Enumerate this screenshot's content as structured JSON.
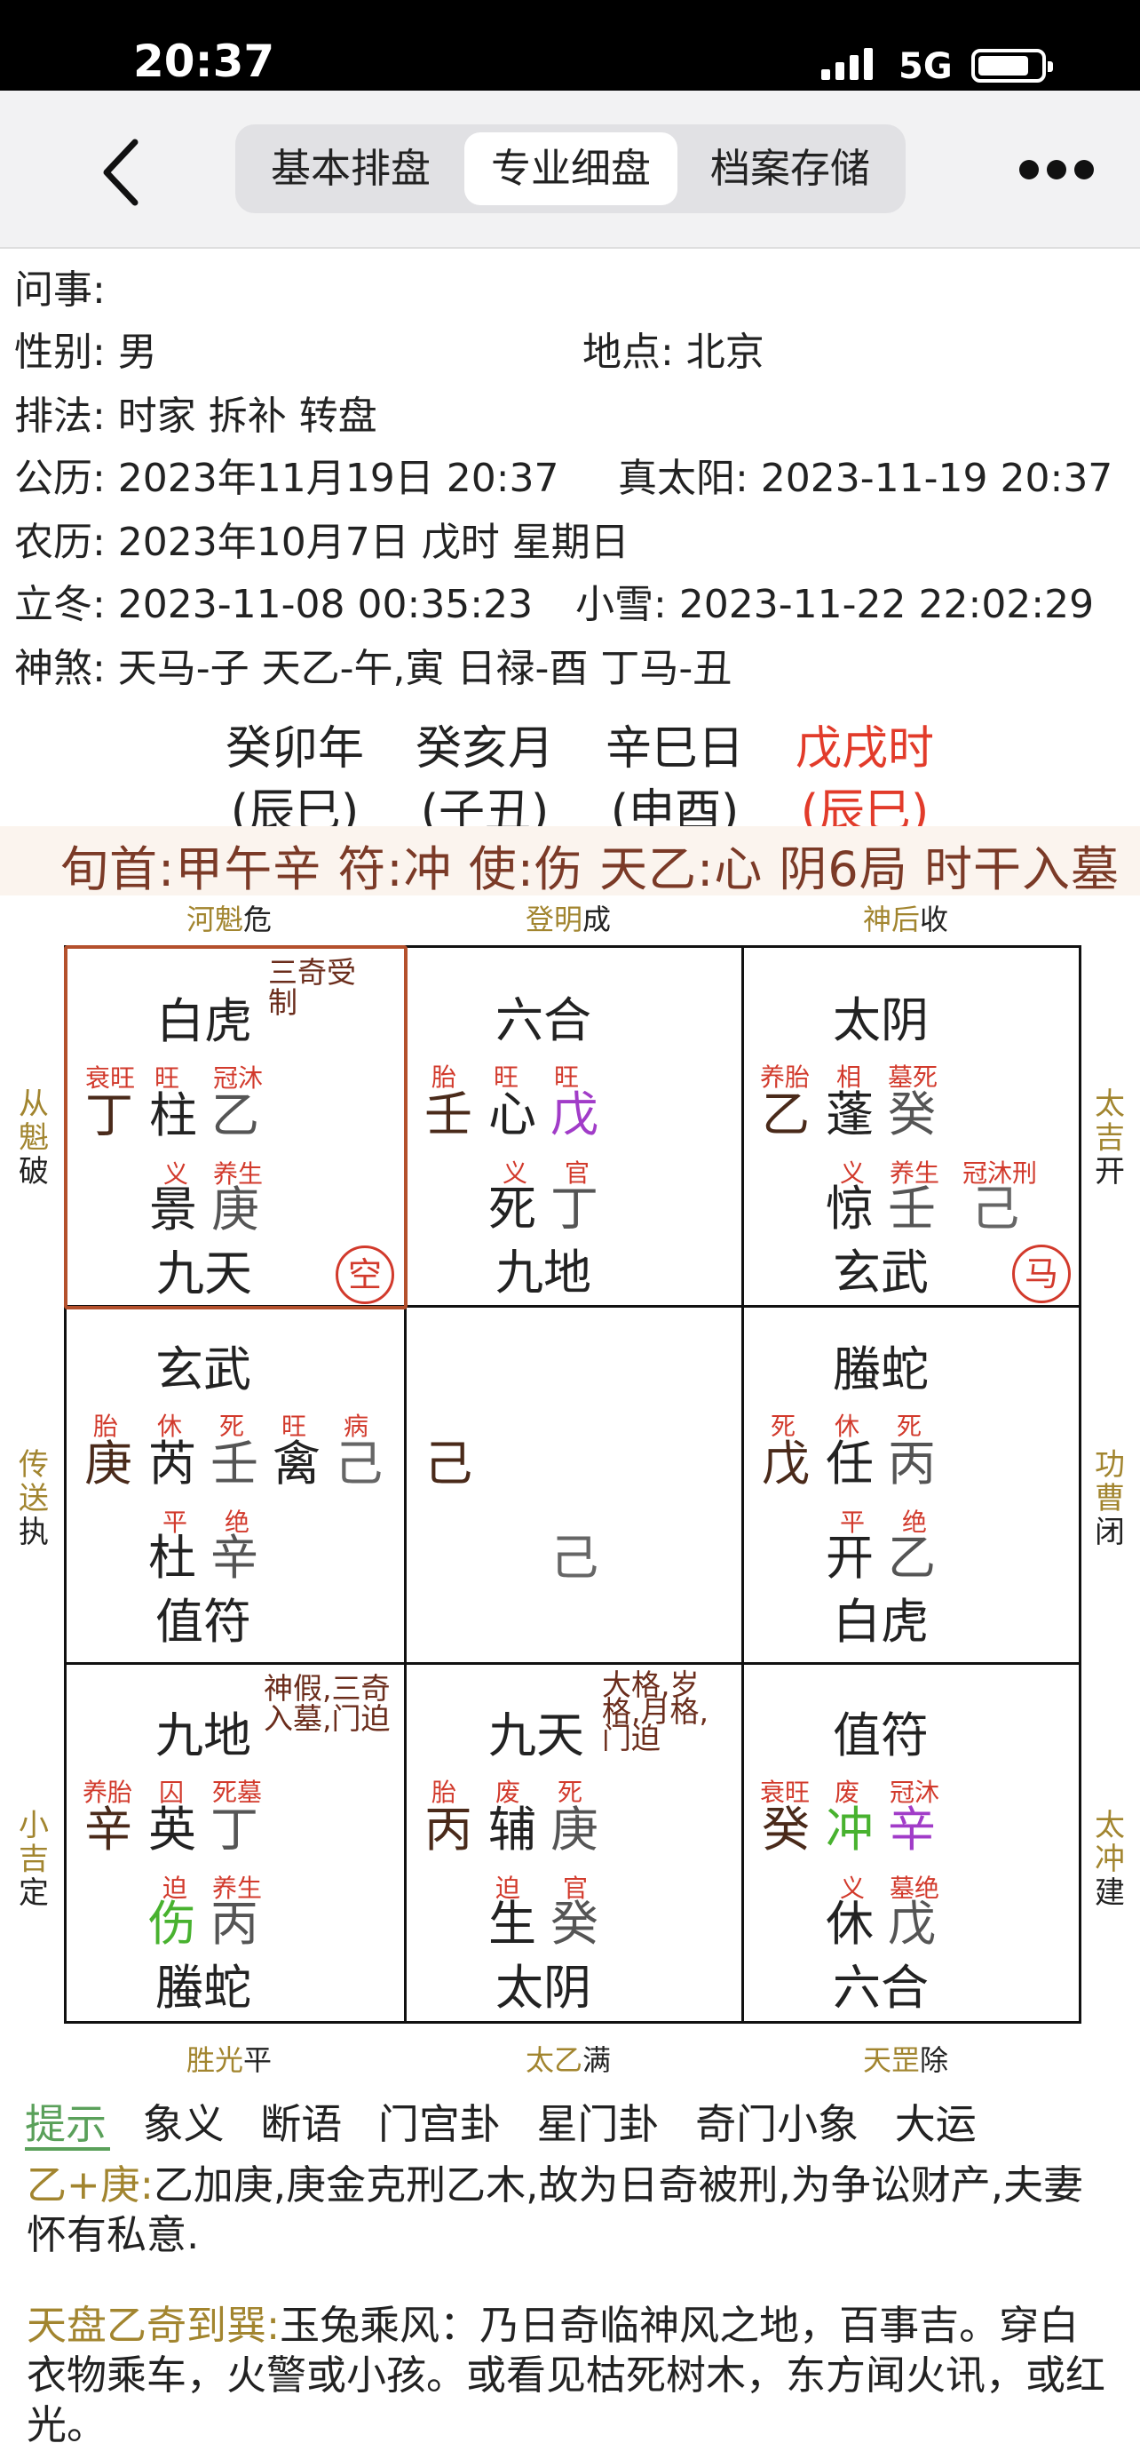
{
  "status": {
    "time": "20:37",
    "network": "5G"
  },
  "nav": {
    "tabs": [
      "基本排盘",
      "专业细盘",
      "档案存储"
    ],
    "active_tab": 1
  },
  "info": {
    "question": "问事:",
    "gender": "性别: 男",
    "location": "地点: 北京",
    "method": "排法: 时家 拆补 转盘",
    "solar": "公历:  2023年11月19日 20:37",
    "true_solar": "真太阳: 2023-11-19 20:37",
    "lunar": "农历:  2023年10月7日 戊时     星期日",
    "term1": "立冬:  2023-11-08 00:35:23",
    "term2": "小雪:  2023-11-22 22:02:29",
    "shensha": "神煞: 天马-子 天乙-午,寅 日禄-酉 丁马-丑"
  },
  "pillars": [
    {
      "gz": "癸卯年",
      "zw": "(辰巳)"
    },
    {
      "gz": "癸亥月",
      "zw": "(子丑)"
    },
    {
      "gz": "辛巳日",
      "zw": "(申酉)"
    },
    {
      "gz": "戊戌时",
      "zw": "(辰巳)"
    }
  ],
  "banner": "旬首:甲午辛 符:冲 使:伤 天乙:心 阴6局 时干入墓",
  "outer": {
    "top": [
      {
        "g": "河魁",
        "s": "危"
      },
      {
        "g": "登明",
        "s": "成"
      },
      {
        "g": "神后",
        "s": "收"
      }
    ],
    "bottom": [
      {
        "g": "胜光",
        "s": "平"
      },
      {
        "g": "太乙",
        "s": "满"
      },
      {
        "g": "天罡",
        "s": "除"
      }
    ],
    "left": [
      {
        "g1": "从",
        "g2": "魁",
        "s": "破"
      },
      {
        "g1": "传",
        "g2": "送",
        "s": "执"
      },
      {
        "g1": "小",
        "g2": "吉",
        "s": "定"
      }
    ],
    "right": [
      {
        "g1": "太",
        "g2": "吉",
        "s": "开"
      },
      {
        "g1": "功",
        "g2": "曹",
        "s": "闭"
      },
      {
        "g1": "太",
        "g2": "冲",
        "s": "建"
      }
    ]
  },
  "palaces": {
    "p0": {
      "note": [
        "三奇受",
        "制"
      ],
      "god": "白虎",
      "s1": "衰旺",
      "s2": "旺",
      "s3": "冠沐",
      "a": "丁",
      "b": "柱",
      "c": "乙",
      "s4": "义",
      "s5": "养生",
      "d": "景",
      "e": "庚",
      "f": "九天",
      "stamp": "空"
    },
    "p1": {
      "god": "六合",
      "s1": "胎",
      "s2": "旺",
      "s3": "旺",
      "a": "壬",
      "b": "心",
      "c": "戊",
      "s4": "义",
      "s5": "官",
      "d": "死",
      "e": "丁",
      "f": "九地"
    },
    "p2": {
      "god": "太阴",
      "s1": "养胎",
      "s2": "相",
      "s3": "墓死",
      "a": "乙",
      "b": "蓬",
      "c": "癸",
      "s4": "义",
      "s5": "养生",
      "s6": "冠沐刑",
      "d": "惊",
      "e": "壬",
      "e2": "己",
      "f": "玄武",
      "stamp": "马"
    },
    "p3": {
      "god": "玄武",
      "s1": "胎",
      "s2": "休",
      "s3": "死",
      "s3b": "旺",
      "s3c": "病",
      "a": "庚",
      "b": "芮",
      "c": "壬",
      "c2": "禽",
      "c3": "己",
      "s4": "平",
      "s5": "绝",
      "d": "杜",
      "e": "辛",
      "f": "值符"
    },
    "p4": {
      "a": "己",
      "b": "己"
    },
    "p5": {
      "god": "螣蛇",
      "s1": "死",
      "s2": "休",
      "s3": "死",
      "a": "戊",
      "b": "任",
      "c": "丙",
      "s4": "平",
      "s5": "绝",
      "d": "开",
      "e": "乙",
      "f": "白虎"
    },
    "p6": {
      "note": [
        "神假,三奇",
        "入墓,门迫"
      ],
      "god": "九地",
      "s1": "养胎",
      "s2": "囚",
      "s3": "死墓",
      "a": "辛",
      "b": "英",
      "c": "丁",
      "s4": "迫",
      "s5": "养生",
      "d": "伤",
      "e": "丙",
      "f": "螣蛇"
    },
    "p7": {
      "note": [
        "大格,岁",
        "格,月格,",
        "门迫"
      ],
      "god": "九天",
      "s1": "胎",
      "s2": "废",
      "s3": "死",
      "a": "丙",
      "b": "辅",
      "c": "庚",
      "s4": "迫",
      "s5": "官",
      "d": "生",
      "e": "癸",
      "f": "太阴"
    },
    "p8": {
      "god": "值符",
      "s1": "衰旺",
      "s2": "废",
      "s3": "冠沐",
      "a": "癸",
      "b": "冲",
      "c": "辛",
      "s4": "义",
      "s5": "墓绝",
      "d": "休",
      "e": "戊",
      "f": "六合"
    }
  },
  "bottom_tabs": [
    "提示",
    "象义",
    "断语",
    "门宫卦",
    "星门卦",
    "奇门小象",
    "大运"
  ],
  "paragraphs": [
    {
      "hl": "乙+庚:",
      "text": "乙加庚,庚金克刑乙木,故为日奇被刑,为争讼财产,夫妻怀有私意."
    },
    {
      "hl": "天盘乙奇到巽:",
      "text": "玉兔乘风：乃日奇临神风之地，百事吉。穿白衣物乘车，火警或小孩。或看见枯死树木，东方闻火讯，或红光。"
    }
  ],
  "colors": {
    "red": "#e23b2a",
    "gold": "#a2852f",
    "purple": "#a13cc8",
    "green": "#48b22f",
    "brown": "#7b3a27"
  }
}
